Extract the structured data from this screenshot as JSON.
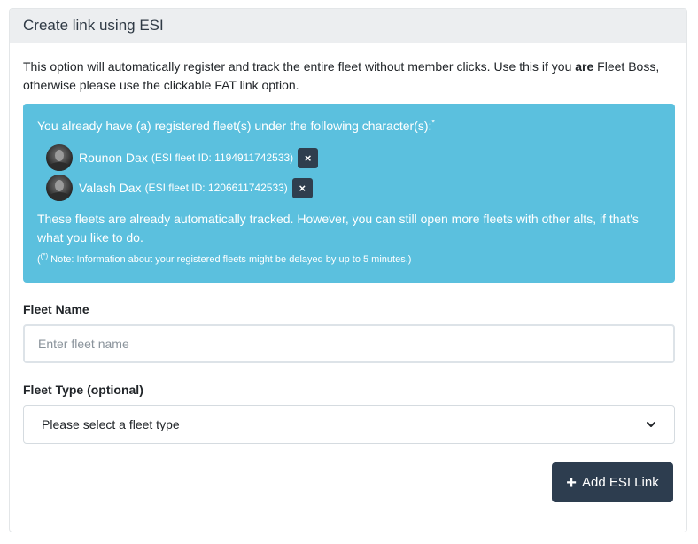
{
  "card": {
    "title": "Create link using ESI",
    "intro_before": "This option will automatically register and track the entire fleet without member clicks. Use this if you ",
    "intro_bold": "are",
    "intro_after": " Fleet Boss, otherwise please use the clickable FAT link option."
  },
  "alert": {
    "title": "You already have (a) registered fleet(s) under the following character(s):",
    "title_mark": "*",
    "characters": [
      {
        "name": "Rounon Dax",
        "meta": "(ESI fleet ID: 1194911742533)",
        "remove_icon": "×"
      },
      {
        "name": "Valash Dax",
        "meta": "(ESI fleet ID: 1206611742533)",
        "remove_icon": "×"
      }
    ],
    "text": "These fleets are already automatically tracked. However, you can still open more fleets with other alts, if that's what you like to do.",
    "note_mark": "(*)",
    "note": " Note: Information about your registered fleets might be delayed by up to 5 minutes.)",
    "note_prefix": "("
  },
  "form": {
    "fleet_name_label": "Fleet Name",
    "fleet_name_placeholder": "Enter fleet name",
    "fleet_name_value": "",
    "fleet_type_label": "Fleet Type (optional)",
    "fleet_type_selected": "Please select a fleet type",
    "submit_label": "Add ESI Link",
    "submit_icon": "+"
  },
  "colors": {
    "alert_bg": "#5bc0de",
    "button_bg": "#2d3d4f",
    "header_bg": "#eceef0"
  }
}
